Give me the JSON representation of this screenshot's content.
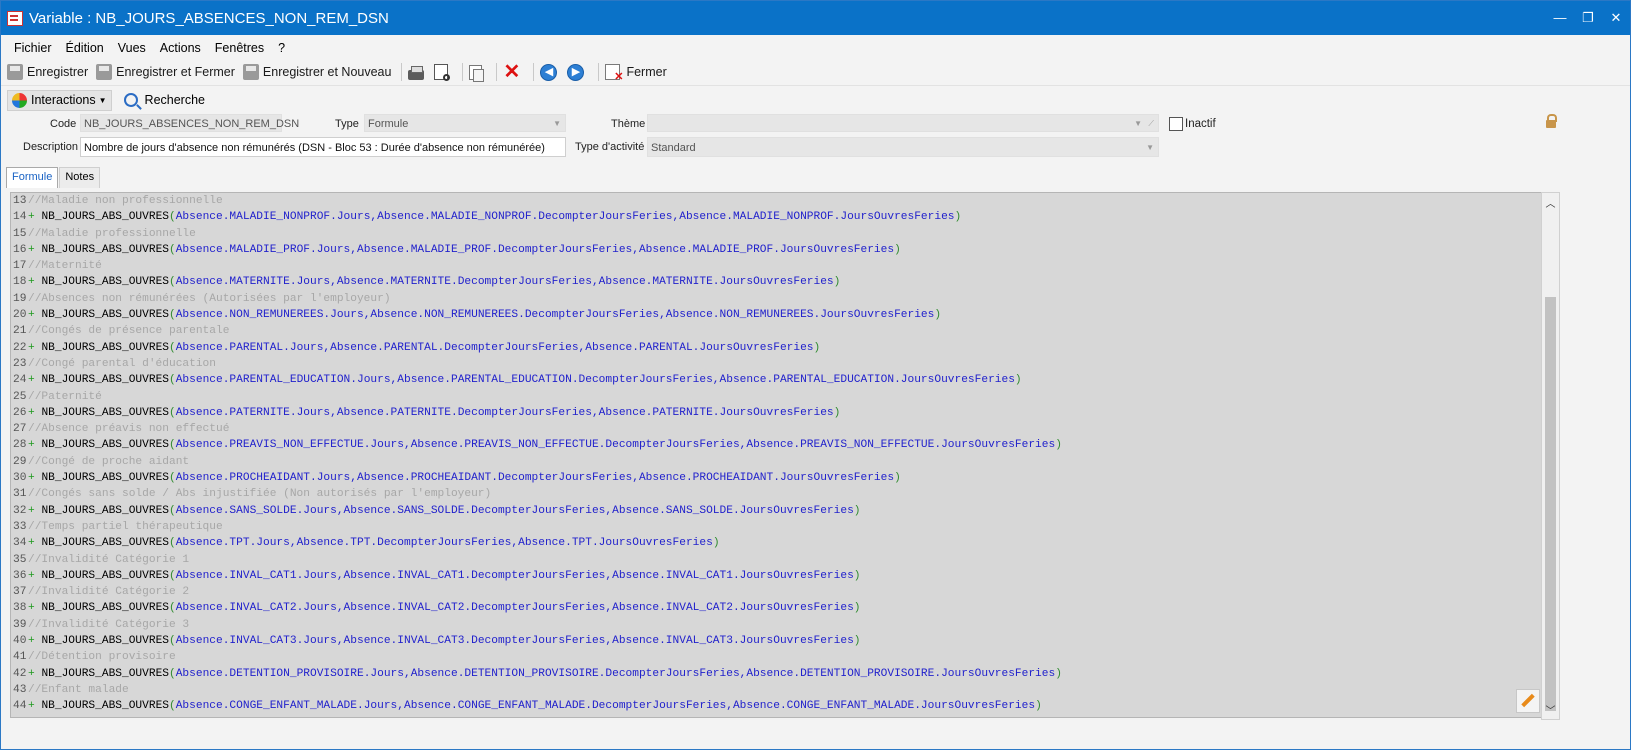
{
  "window": {
    "title": "Variable : NB_JOURS_ABSENCES_NON_REM_DSN",
    "controls": {
      "minimize": "—",
      "maximize": "❐",
      "close": "✕"
    }
  },
  "menu": [
    "Fichier",
    "Édition",
    "Vues",
    "Actions",
    "Fenêtres",
    "?"
  ],
  "toolbar": {
    "save": "Enregistrer",
    "save_close": "Enregistrer et Fermer",
    "save_new": "Enregistrer et Nouveau",
    "close": "Fermer"
  },
  "toolbar2": {
    "interactions": "Interactions",
    "search": "Recherche"
  },
  "form": {
    "code_label": "Code",
    "code_value": "NB_JOURS_ABSENCES_NON_REM_DSN",
    "type_label": "Type",
    "type_value": "Formule",
    "theme_label": "Thème",
    "theme_value": "",
    "inactive_label": "Inactif",
    "description_label": "Description",
    "description_value": "Nombre de jours d'absence non rémunérés (DSN - Bloc 53 : Durée d'absence non rémunérée)",
    "activity_label": "Type d'activité",
    "activity_value": "Standard"
  },
  "tabs": [
    "Formule",
    "Notes"
  ],
  "code_lines": [
    {
      "n": "13",
      "comment": "//Maladie non professionnelle"
    },
    {
      "n": "14",
      "code": "Absence.MALADIE_NONPROF.Jours,Absence.MALADIE_NONPROF.DecompterJoursFeries,Absence.MALADIE_NONPROF.JoursOuvresFeries"
    },
    {
      "n": "15",
      "comment": "//Maladie professionnelle"
    },
    {
      "n": "16",
      "code": "Absence.MALADIE_PROF.Jours,Absence.MALADIE_PROF.DecompterJoursFeries,Absence.MALADIE_PROF.JoursOuvresFeries"
    },
    {
      "n": "17",
      "comment": "//Maternité"
    },
    {
      "n": "18",
      "code": "Absence.MATERNITE.Jours,Absence.MATERNITE.DecompterJoursFeries,Absence.MATERNITE.JoursOuvresFeries"
    },
    {
      "n": "19",
      "comment": "//Absences non rémunérées (Autorisées par l'employeur)"
    },
    {
      "n": "20",
      "code": "Absence.NON_REMUNEREES.Jours,Absence.NON_REMUNEREES.DecompterJoursFeries,Absence.NON_REMUNEREES.JoursOuvresFeries"
    },
    {
      "n": "21",
      "comment": "//Congés de présence parentale"
    },
    {
      "n": "22",
      "code": "Absence.PARENTAL.Jours,Absence.PARENTAL.DecompterJoursFeries,Absence.PARENTAL.JoursOuvresFeries"
    },
    {
      "n": "23",
      "comment": "//Congé parental d'éducation"
    },
    {
      "n": "24",
      "code": "Absence.PARENTAL_EDUCATION.Jours,Absence.PARENTAL_EDUCATION.DecompterJoursFeries,Absence.PARENTAL_EDUCATION.JoursOuvresFeries"
    },
    {
      "n": "25",
      "comment": "//Paternité"
    },
    {
      "n": "26",
      "code": "Absence.PATERNITE.Jours,Absence.PATERNITE.DecompterJoursFeries,Absence.PATERNITE.JoursOuvresFeries"
    },
    {
      "n": "27",
      "comment": "//Absence préavis non effectué"
    },
    {
      "n": "28",
      "code": "Absence.PREAVIS_NON_EFFECTUE.Jours,Absence.PREAVIS_NON_EFFECTUE.DecompterJoursFeries,Absence.PREAVIS_NON_EFFECTUE.JoursOuvresFeries"
    },
    {
      "n": "29",
      "comment": "//Congé de proche aidant"
    },
    {
      "n": "30",
      "code": "Absence.PROCHEAIDANT.Jours,Absence.PROCHEAIDANT.DecompterJoursFeries,Absence.PROCHEAIDANT.JoursOuvresFeries"
    },
    {
      "n": "31",
      "comment": "//Congés sans solde / Abs injustifiée (Non autorisés par l'employeur)"
    },
    {
      "n": "32",
      "code": "Absence.SANS_SOLDE.Jours,Absence.SANS_SOLDE.DecompterJoursFeries,Absence.SANS_SOLDE.JoursOuvresFeries"
    },
    {
      "n": "33",
      "comment": "//Temps partiel thérapeutique"
    },
    {
      "n": "34",
      "code": "Absence.TPT.Jours,Absence.TPT.DecompterJoursFeries,Absence.TPT.JoursOuvresFeries"
    },
    {
      "n": "35",
      "comment": "//Invalidité Catégorie 1"
    },
    {
      "n": "36",
      "code": "Absence.INVAL_CAT1.Jours,Absence.INVAL_CAT1.DecompterJoursFeries,Absence.INVAL_CAT1.JoursOuvresFeries"
    },
    {
      "n": "37",
      "comment": "//Invalidité Catégorie 2"
    },
    {
      "n": "38",
      "code": "Absence.INVAL_CAT2.Jours,Absence.INVAL_CAT2.DecompterJoursFeries,Absence.INVAL_CAT2.JoursOuvresFeries"
    },
    {
      "n": "39",
      "comment": "//Invalidité Catégorie 3"
    },
    {
      "n": "40",
      "code": "Absence.INVAL_CAT3.Jours,Absence.INVAL_CAT3.DecompterJoursFeries,Absence.INVAL_CAT3.JoursOuvresFeries"
    },
    {
      "n": "41",
      "comment": "//Détention provisoire"
    },
    {
      "n": "42",
      "code": "Absence.DETENTION_PROVISOIRE.Jours,Absence.DETENTION_PROVISOIRE.DecompterJoursFeries,Absence.DETENTION_PROVISOIRE.JoursOuvresFeries"
    },
    {
      "n": "43",
      "comment": "//Enfant malade"
    },
    {
      "n": "44",
      "code": "Absence.CONGE_ENFANT_MALADE.Jours,Absence.CONGE_ENFANT_MALADE.DecompterJoursFeries,Absence.CONGE_ENFANT_MALADE.JoursOuvresFeries"
    }
  ],
  "code_prefix": {
    "plus": "+",
    "fn": "NB_JOURS_ABS_OUVRES",
    "open": "(",
    "close": ")"
  }
}
